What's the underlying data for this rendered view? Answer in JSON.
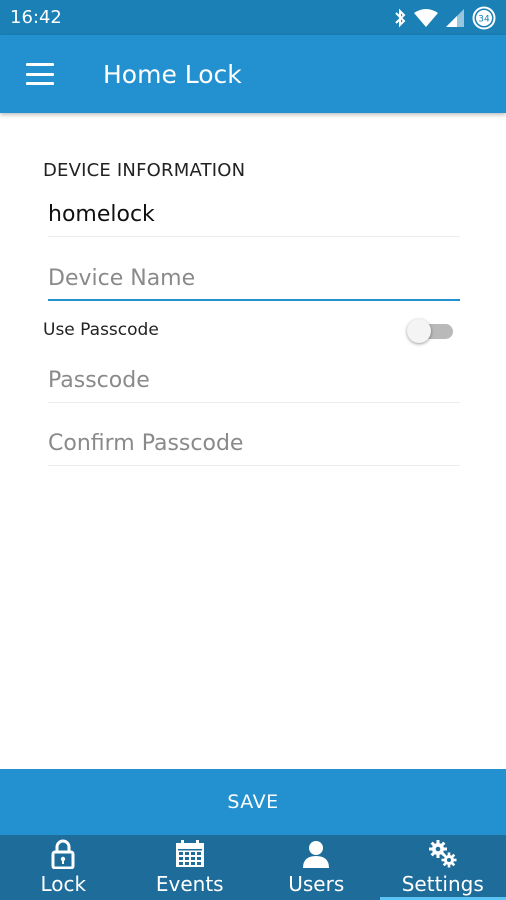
{
  "status_bar": {
    "time": "16:42",
    "battery_level": "34"
  },
  "app_bar": {
    "title": "Home Lock"
  },
  "form": {
    "section_title": "DEVICE INFORMATION",
    "device_id_value": "homelock",
    "device_name_placeholder": "Device Name",
    "use_passcode_label": "Use Passcode",
    "use_passcode_enabled": false,
    "passcode_placeholder": "Passcode",
    "confirm_passcode_placeholder": "Confirm Passcode"
  },
  "save_button": {
    "label": "SAVE"
  },
  "bottom_nav": {
    "items": [
      {
        "label": "Lock",
        "icon": "lock-icon"
      },
      {
        "label": "Events",
        "icon": "calendar-icon"
      },
      {
        "label": "Users",
        "icon": "user-icon"
      },
      {
        "label": "Settings",
        "icon": "gears-icon"
      }
    ],
    "active": "Settings"
  },
  "colors": {
    "status_bar": "#1a80b6",
    "app_bar": "#2391cf",
    "bottom_nav": "#1e6c9a",
    "accent": "#2391cf"
  }
}
